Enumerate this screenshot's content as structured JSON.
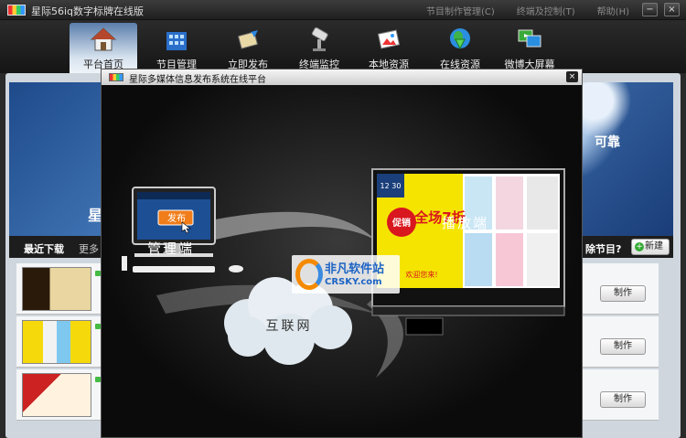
{
  "app": {
    "title": "星际56iq数字标牌在线版"
  },
  "top_menu": [
    "节目制作管理(C)",
    "终端及控制(T)",
    "帮助(H)"
  ],
  "window_buttons": {
    "minimize": "−",
    "close": "×"
  },
  "toolbar": [
    {
      "label": "平台首页",
      "icon": "home-icon",
      "active": true
    },
    {
      "label": "节目管理",
      "icon": "building-icon"
    },
    {
      "label": "立即发布",
      "icon": "publish-arrow-icon"
    },
    {
      "label": "终端监控",
      "icon": "camera-icon"
    },
    {
      "label": "本地资源",
      "icon": "image-icon"
    },
    {
      "label": "在线资源",
      "icon": "globe-download-icon"
    },
    {
      "label": "微博大屏幕",
      "icon": "screens-icon"
    }
  ],
  "banner": {
    "slogan": "可靠",
    "char": "星"
  },
  "recent": {
    "title": "最近下载",
    "more": "更多",
    "new_question": "除节目?",
    "new_button": "新建"
  },
  "templates": [
    {
      "make_label": "制作"
    },
    {
      "make_label": "制作"
    },
    {
      "make_label": "制作"
    }
  ],
  "dialog": {
    "title": "星际多媒体信息发布系统在线平台",
    "close": "×",
    "manage_label": "管理端",
    "player_label": "播放端",
    "internet_label": "互联网",
    "publish_button": "发布",
    "watermark_cn": "非凡软件站",
    "watermark_en": "CRSKY.com",
    "promo_date": "12  30",
    "promo_badge": "促销",
    "promo_text": "全场7折",
    "promo_sub": "欢迎您来!"
  },
  "colors": {
    "accent": "#4f86c6",
    "promo_yellow": "#f5e400",
    "promo_red": "#d9171e"
  }
}
